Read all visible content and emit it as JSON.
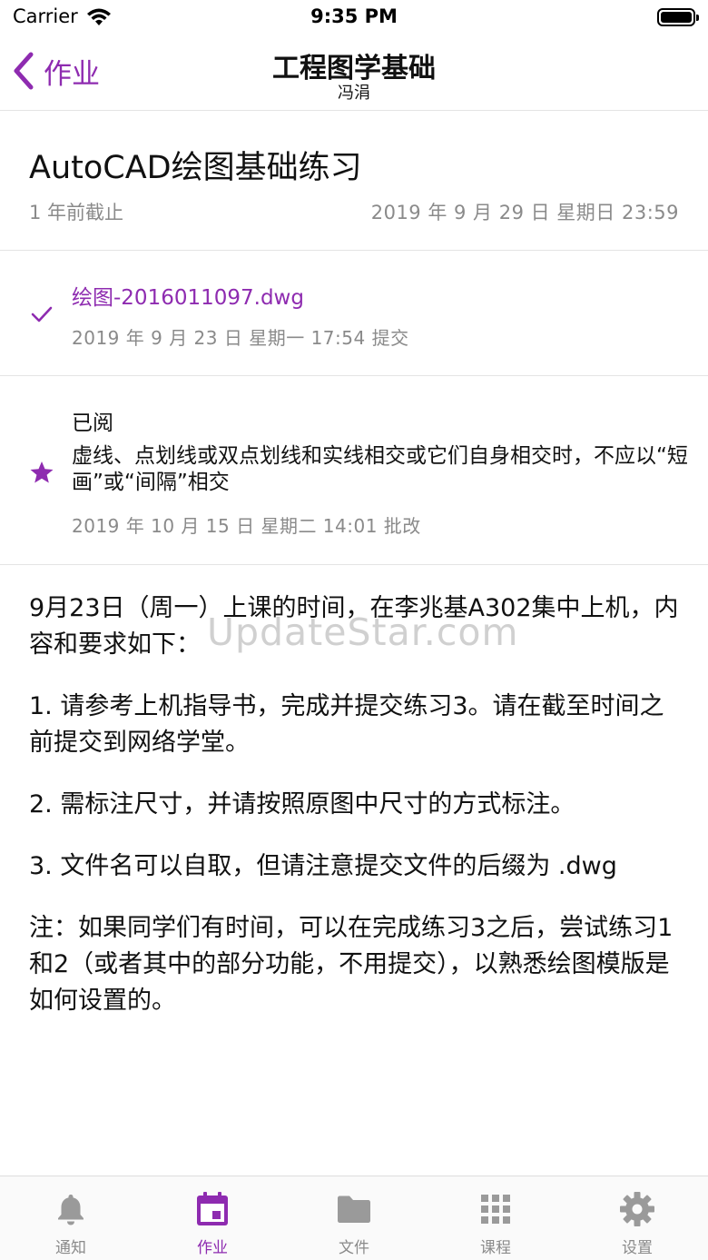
{
  "status_bar": {
    "carrier": "Carrier",
    "time": "9:35 PM"
  },
  "nav": {
    "back_label": "作业",
    "title": "工程图学基础",
    "subtitle": "冯涓"
  },
  "homework": {
    "title": "AutoCAD绘图基础练习",
    "deadline_relative": "1 年前截止",
    "deadline_absolute": "2019 年 9 月 29 日 星期日 23:59"
  },
  "submission": {
    "file": "绘图-2016011097.dwg",
    "time": "2019 年 9 月 23 日 星期一 17:54 提交",
    "icon": "check-icon"
  },
  "grade": {
    "status": "已阅",
    "comment": "虚线、点划线或双点划线和实线相交或它们自身相交时，不应以“短画”或“间隔”相交",
    "time": "2019 年 10 月 15 日 星期二 14:01 批改",
    "icon": "star-icon"
  },
  "content": {
    "paragraphs": [
      "9月23日（周一）上课的时间，在李兆基A302集中上机，内容和要求如下：",
      "1. 请参考上机指导书，完成并提交练习3。请在截至时间之前提交到网络学堂。",
      "2. 需标注尺寸，并请按照原图中尺寸的方式标注。",
      "3. 文件名可以自取，但请注意提交文件的后缀为 .dwg",
      "注：如果同学们有时间，可以在完成练习3之后，尝试练习1和2（或者其中的部分功能，不用提交），以熟悉绘图模版是如何设置的。"
    ]
  },
  "watermark": "UpdateStar.com",
  "tabs": [
    {
      "label": "通知",
      "icon": "bell-icon",
      "active": false
    },
    {
      "label": "作业",
      "icon": "calendar-icon",
      "active": true
    },
    {
      "label": "文件",
      "icon": "folder-icon",
      "active": false
    },
    {
      "label": "课程",
      "icon": "grid-icon",
      "active": false
    },
    {
      "label": "设置",
      "icon": "gear-icon",
      "active": false
    }
  ],
  "colors": {
    "accent": "#8e2bb0",
    "secondary_text": "#8a8a8a",
    "inactive_icon": "#9a9a9a",
    "divider": "#e4e4e4"
  }
}
